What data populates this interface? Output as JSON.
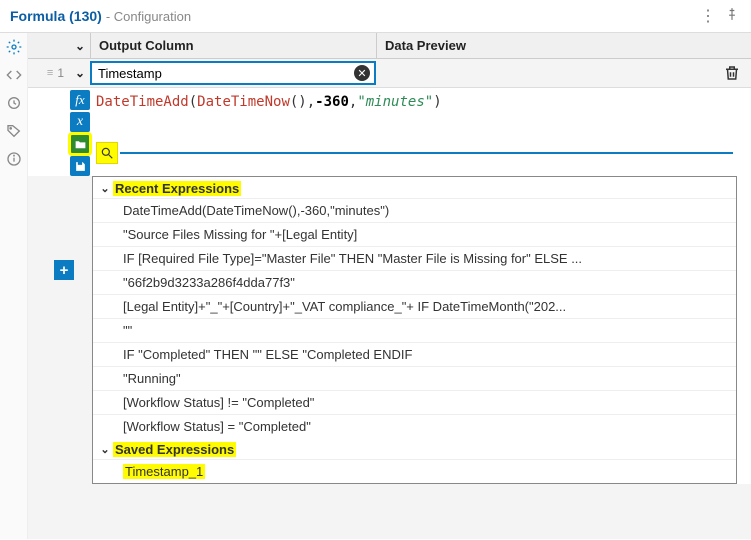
{
  "title": {
    "main": "Formula (130)",
    "sub": "- Configuration"
  },
  "headers": {
    "output_column": "Output Column",
    "data_preview": "Data Preview"
  },
  "row_number": "1",
  "field": {
    "value": "Timestamp"
  },
  "formula": {
    "fn1": "DateTimeAdd",
    "fn2": "DateTimeNow",
    "num": "-360",
    "str": "\"minutes\""
  },
  "sections": {
    "recent": "Recent Expressions",
    "saved": "Saved Expressions"
  },
  "recent_items": [
    "DateTimeAdd(DateTimeNow(),-360,\"minutes\")",
    "\"Source Files Missing for \"+[Legal Entity]",
    "IF [Required File Type]=\"Master File\" THEN \"Master File is Missing for\" ELSE ...",
    "\"66f2b9d3233a286f4dda77f3\"",
    "[Legal Entity]+\"_\"+[Country]+\"_VAT compliance_\"+ IF DateTimeMonth(\"202...",
    "\"\"",
    "IF \"Completed\" THEN \"\" ELSE \"Completed ENDIF",
    "\"Running\"",
    "[Workflow Status] != \"Completed\"",
    "[Workflow Status] = \"Completed\""
  ],
  "saved_items": [
    "Timestamp_1"
  ],
  "icons": {
    "fx": "fx",
    "var": "x"
  }
}
